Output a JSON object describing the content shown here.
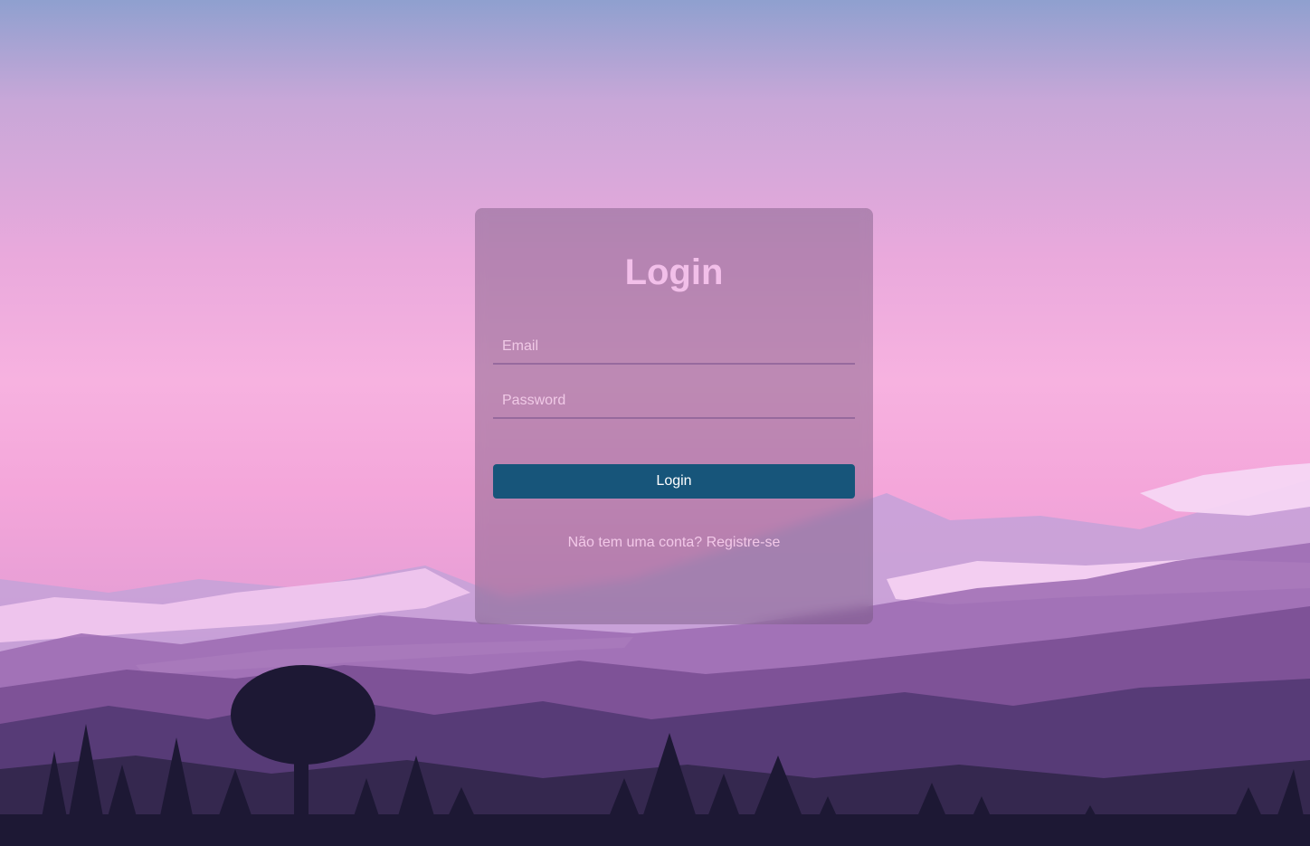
{
  "login": {
    "title": "Login",
    "email": {
      "placeholder": "Email",
      "value": ""
    },
    "password": {
      "placeholder": "Password",
      "value": ""
    },
    "submit_label": "Login",
    "register_prompt": "Não tem uma conta?",
    "register_link": "Registre-se"
  },
  "colors": {
    "button": "#17557a",
    "title": "#f2bfe9",
    "card": "rgba(110,80,120,0.42)"
  }
}
